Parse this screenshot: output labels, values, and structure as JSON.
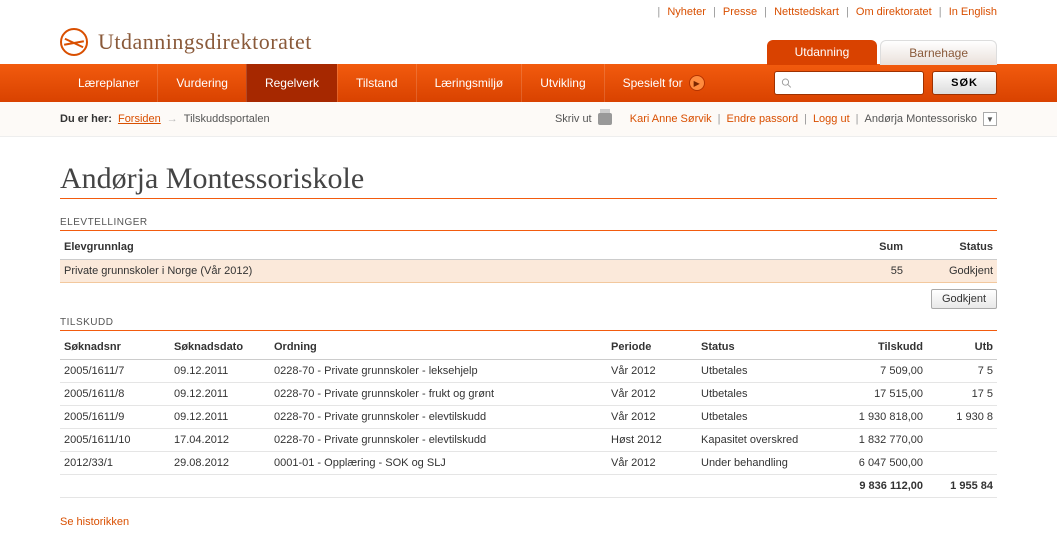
{
  "toplinks": [
    "Nyheter",
    "Presse",
    "Nettstedskart",
    "Om direktoratet",
    "In English"
  ],
  "brand": "Utdanningsdirektoratet",
  "section_tabs": {
    "active": "Utdanning",
    "inactive": "Barnehage"
  },
  "nav": {
    "items": [
      "Læreplaner",
      "Vurdering",
      "Regelverk",
      "Tilstand",
      "Læringsmiljø",
      "Utvikling"
    ],
    "spesielt": "Spesielt for",
    "active_index": 2,
    "sok": "SØK"
  },
  "breadcrumb": {
    "prefix": "Du er her:",
    "home": "Forsiden",
    "current": "Tilskuddsportalen"
  },
  "userbar": {
    "print": "Skriv ut",
    "user": "Kari Anne Sørvik",
    "change_pw": "Endre passord",
    "logout": "Logg ut",
    "org": "Andørja Montessorisko"
  },
  "page_title": "Andørja Montessoriskole",
  "elev": {
    "section": "ELEVTELLINGER",
    "headers": {
      "grunnlag": "Elevgrunnlag",
      "sum": "Sum",
      "status": "Status"
    },
    "row": {
      "grunnlag": "Private grunnskoler i Norge (Vår 2012)",
      "sum": "55",
      "status": "Godkjent"
    }
  },
  "godkjent_button": "Godkjent",
  "tilskudd": {
    "section": "TILSKUDD",
    "headers": {
      "nr": "Søknadsnr",
      "dato": "Søknadsdato",
      "ordning": "Ordning",
      "periode": "Periode",
      "status": "Status",
      "tilskudd": "Tilskudd",
      "utb": "Utb"
    },
    "rows": [
      {
        "nr": "2005/1611/7",
        "dato": "09.12.2011",
        "ordning": "0228-70 - Private grunnskoler - leksehjelp",
        "periode": "Vår 2012",
        "status": "Utbetales",
        "tilskudd": "7 509,00",
        "utb": "7 5"
      },
      {
        "nr": "2005/1611/8",
        "dato": "09.12.2011",
        "ordning": "0228-70 - Private grunnskoler - frukt og grønt",
        "periode": "Vår 2012",
        "status": "Utbetales",
        "tilskudd": "17 515,00",
        "utb": "17 5"
      },
      {
        "nr": "2005/1611/9",
        "dato": "09.12.2011",
        "ordning": "0228-70 - Private grunnskoler - elevtilskudd",
        "periode": "Vår 2012",
        "status": "Utbetales",
        "tilskudd": "1 930 818,00",
        "utb": "1 930 8"
      },
      {
        "nr": "2005/1611/10",
        "dato": "17.04.2012",
        "ordning": "0228-70 - Private grunnskoler - elevtilskudd",
        "periode": "Høst 2012",
        "status": "Kapasitet overskred",
        "tilskudd": "1 832 770,00",
        "utb": ""
      },
      {
        "nr": "2012/33/1",
        "dato": "29.08.2012",
        "ordning": "0001-01 - Opplæring - SOK og SLJ",
        "periode": "Vår 2012",
        "status": "Under behandling",
        "tilskudd": "6 047 500,00",
        "utb": ""
      }
    ],
    "total": {
      "tilskudd": "9 836 112,00",
      "utb": "1 955 84"
    }
  },
  "historikk": "Se historikken"
}
